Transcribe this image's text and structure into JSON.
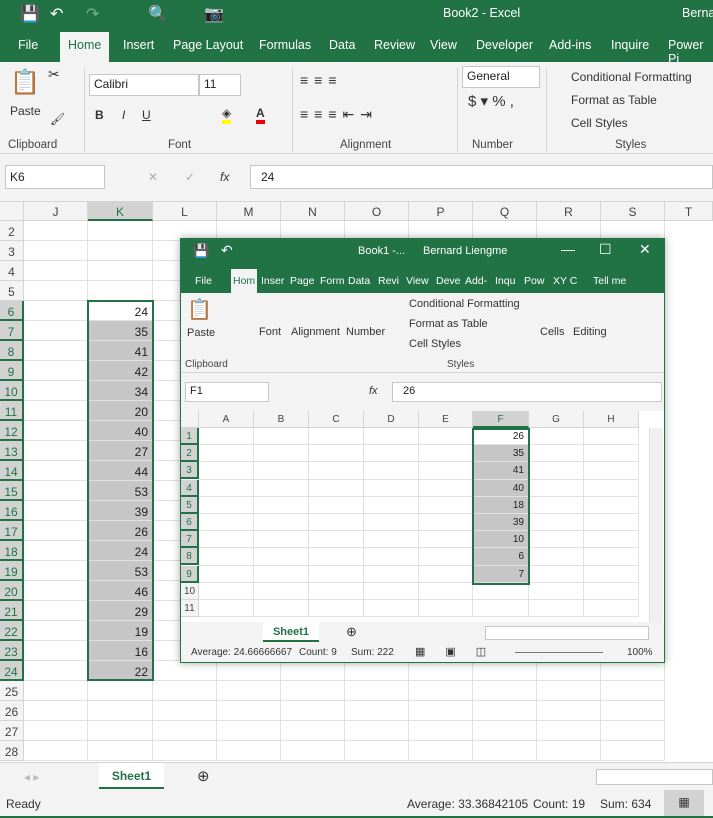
{
  "main": {
    "title": "Book2  -  Excel",
    "user": "Berna",
    "tabs": [
      "File",
      "Home",
      "Insert",
      "Page Layout",
      "Formulas",
      "Data",
      "Review",
      "View",
      "Developer",
      "Add-ins",
      "Inquire",
      "Power Pi"
    ],
    "ribbon": {
      "paste": "Paste",
      "font_name": "Calibri",
      "font_size": "11",
      "number_format": "General",
      "conditional": "Conditional Formatting",
      "format_table": "Format as Table",
      "cell_styles": "Cell Styles",
      "groups": [
        "Clipboard",
        "Font",
        "Alignment",
        "Number",
        "Styles"
      ]
    },
    "name_box": "K6",
    "formula": "24",
    "fx": "fx",
    "columns": [
      "J",
      "K",
      "L",
      "M",
      "N",
      "O",
      "P",
      "Q",
      "R",
      "S",
      "T"
    ],
    "rows": [
      "2",
      "3",
      "4",
      "5",
      "6",
      "7",
      "8",
      "9",
      "10",
      "11",
      "12",
      "13",
      "14",
      "15",
      "16",
      "17",
      "18",
      "19",
      "20",
      "21",
      "22",
      "23",
      "24",
      "25",
      "26",
      "27",
      "28"
    ],
    "selected_column": "K",
    "selected_rows": [
      6,
      24
    ],
    "values": [
      24,
      35,
      41,
      42,
      34,
      20,
      40,
      27,
      44,
      53,
      39,
      26,
      24,
      53,
      46,
      29,
      19,
      16,
      22
    ],
    "sheet_tab": "Sheet1",
    "status": "Ready",
    "average": "Average: 33.36842105",
    "count": "Count: 19",
    "sum": "Sum: 634"
  },
  "inner": {
    "title": "Book1  -...",
    "user": "Bernard Liengme",
    "tabs": [
      "File",
      "Hom",
      "Inser",
      "Page",
      "Form",
      "Data",
      "Revi",
      "View",
      "Deve",
      "Add-",
      "Inqu",
      "Pow",
      "XY C",
      "Tell me"
    ],
    "ribbon": {
      "paste": "Paste",
      "font": "Font",
      "alignment": "Alignment",
      "number": "Number",
      "conditional": "Conditional Formatting",
      "format_table": "Format as Table",
      "cell_styles": "Cell Styles",
      "cells": "Cells",
      "editing": "Editing",
      "clipboard": "Clipboard",
      "styles": "Styles"
    },
    "name_box": "F1",
    "formula": "26",
    "fx": "fx",
    "columns": [
      "A",
      "B",
      "C",
      "D",
      "E",
      "F",
      "G",
      "H"
    ],
    "rows": [
      "1",
      "2",
      "3",
      "4",
      "5",
      "6",
      "7",
      "8",
      "9",
      "10",
      "11"
    ],
    "values": [
      26,
      35,
      41,
      40,
      18,
      39,
      10,
      6,
      7
    ],
    "sheet_tab": "Sheet1",
    "average": "Average: 24.66666667",
    "count": "Count: 9",
    "sum": "Sum: 222",
    "zoom": "100%"
  },
  "colors": {
    "accent": "#217346",
    "selection": "#c6c6c6"
  }
}
